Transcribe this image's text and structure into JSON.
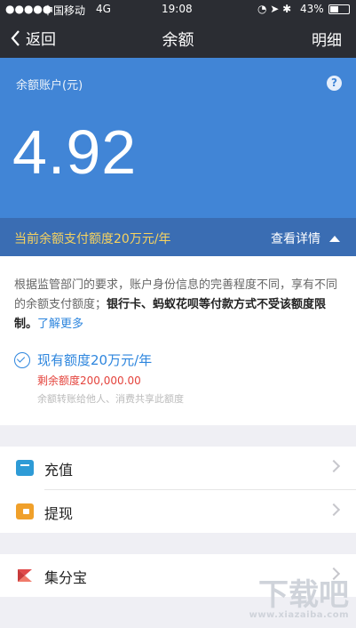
{
  "status_bar": {
    "carrier": "中国移动",
    "network": "4G",
    "time": "19:08",
    "battery": "43%"
  },
  "nav": {
    "back_label": "返回",
    "title": "余额",
    "right_label": "明细"
  },
  "balance": {
    "label": "余额账户(元)",
    "amount": "4.92",
    "help_icon": "question-icon"
  },
  "limit_bar": {
    "text": "当前余额支付额度20万元/年",
    "link": "查看详情",
    "text_color": "#f7d35f"
  },
  "info": {
    "text_normal": "根据监管部门的要求，账户身份信息的完善程度不同，享有不同的余额支付额度；",
    "text_bold": "银行卡、蚂蚁花呗等付款方式不受该额度限制。",
    "link": "了解更多"
  },
  "quota": {
    "title": "现有额度20万元/年",
    "remaining": "剩余额度200,000.00",
    "note": "余额转账给他人、消费共享此额度"
  },
  "menu": [
    {
      "label": "充值",
      "icon": "recharge-icon",
      "color": "#2e9bd6"
    },
    {
      "label": "提现",
      "icon": "withdraw-icon",
      "color": "#f0a02a"
    },
    {
      "label": "集分宝",
      "icon": "jifenbao-icon",
      "color": "#e04a4a"
    }
  ],
  "watermark": {
    "text": "下载吧",
    "url": "www.xiazaiba.com"
  },
  "colors": {
    "header": "#2b2d33",
    "hero": "#4185d6",
    "limit_bar": "#3a6db3",
    "link": "#2e86de",
    "alert": "#e4433c"
  }
}
